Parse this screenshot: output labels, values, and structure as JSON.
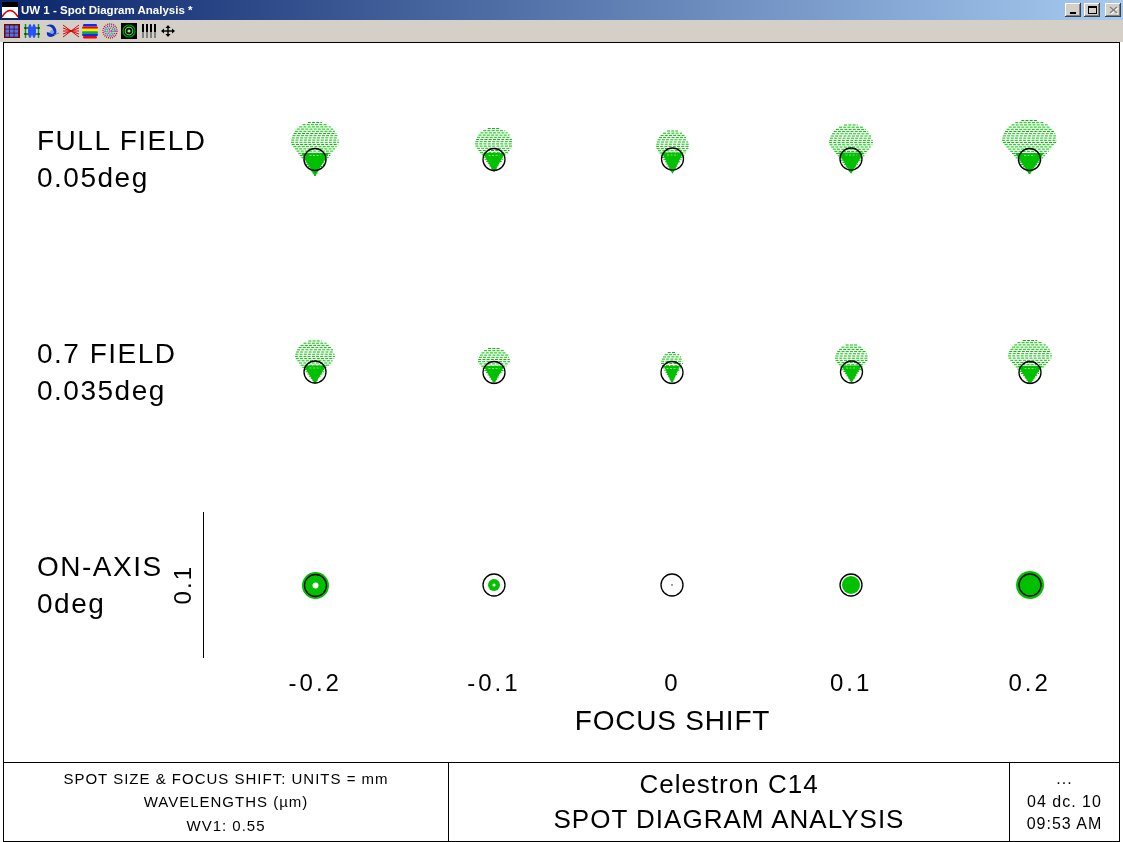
{
  "window": {
    "title": "UW 1 - Spot Diagram Analysis *",
    "buttons": [
      {
        "kind": "minimize",
        "disabled": false
      },
      {
        "kind": "maximize",
        "disabled": false
      },
      {
        "kind": "close",
        "disabled": true
      }
    ]
  },
  "plot": {
    "rows": [
      {
        "field": "FULL FIELD",
        "angle": "0.05deg"
      },
      {
        "field": "0.7 FIELD",
        "angle": "0.035deg"
      },
      {
        "field": "ON-AXIS",
        "angle": "0deg",
        "scale_label": "0.1"
      }
    ],
    "focus_shifts": [
      "-0.2",
      "-0.1",
      "0",
      "0.1",
      "0.2"
    ],
    "xlabel": "FOCUS SHIFT"
  },
  "footer": {
    "units_lines": [
      "SPOT SIZE & FOCUS SHIFT: UNITS = mm",
      "WAVELENGTHS (µm)",
      "WV1: 0.55"
    ],
    "title_lines": [
      "Celestron C14",
      "SPOT DIAGRAM ANALYSIS"
    ],
    "stamp_lines": [
      "...",
      "04 dc. 10",
      "09:53 AM"
    ]
  }
}
